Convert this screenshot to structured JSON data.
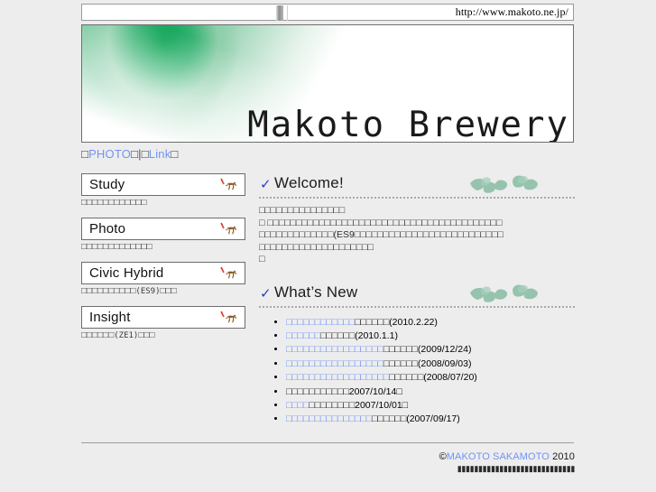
{
  "browser": {
    "url": "http://www.makoto.ne.jp/"
  },
  "banner": {
    "title": "Makoto Brewery",
    "gradient_color": "#00a04c"
  },
  "topnav": {
    "items": [
      {
        "label": "〇PHOTO〇",
        "type": "link"
      },
      {
        "label": "|",
        "type": "separator"
      },
      {
        "label": "〇Link〇",
        "type": "link"
      }
    ],
    "link_color": "#6f94f7",
    "raw": "□PHOTO□|□Link□"
  },
  "sidebar": {
    "items": [
      {
        "label": "Study",
        "caption": "□□□□□□□□□□□□",
        "icon": "cat-icon"
      },
      {
        "label": "Photo",
        "caption": "□□□□□□□□□□□□□",
        "icon": "cat-icon"
      },
      {
        "label": "Civic Hybrid",
        "caption_pre": "□□□□□□□□□□",
        "caption_code": "(ES9)",
        "caption_post": "□□□",
        "icon": "cat-icon"
      },
      {
        "label": "Insight",
        "caption_pre": "□□□□□□",
        "caption_code": "(ZE1)",
        "caption_post": "□□□",
        "icon": "cat-icon"
      }
    ]
  },
  "welcome": {
    "check": "✓",
    "title": "Welcome!",
    "lines": [
      "□□□□□□□□□□□□□□□",
      "□ □□□□□□□□□□□□□□□□□□□□□□□□□□□□□□□□□□□□□□□□□",
      "□□□□□□□□□□□□□(ES9□□□□□□□□□□□□□□□□□□□□□□□□□□",
      "□□□□□□□□□□□□□□□□□□□□",
      "□"
    ]
  },
  "whats_new": {
    "check": "✓",
    "title": "What’s New",
    "items": [
      {
        "link_text": "□□□□□□□□□□□□",
        "black_text": "□□□□□□",
        "date": "(2010.2.22)"
      },
      {
        "link_text": "□□□□□□",
        "black_text": "□□□□□□",
        "date": "(2010.1.1)"
      },
      {
        "link_text": "□□□□□□□□□□□□□□□□□",
        "black_text": "□□□□□□",
        "date": "(2009/12/24)"
      },
      {
        "link_text": "□□□□□□□□□□□□□□□□□",
        "black_text": "□□□□□□",
        "date": "(2008/09/03)"
      },
      {
        "link_text": "□□□□□□□□□□□□□□□□□□",
        "black_text": "□□□□□□",
        "date": "(2008/07/20)"
      },
      {
        "link_text": "",
        "black_text": "□□□□□□□□□□□",
        "date": "2007/10/14□"
      },
      {
        "link_text": "□□□□",
        "black_text": "□□□□□□□□",
        "date": "2007/10/01□"
      },
      {
        "link_text": "□□□□□□□□□□□□□□□",
        "black_text": "□□□□□□",
        "date": "(2007/09/17)"
      }
    ]
  },
  "footer": {
    "copyright_symbol": "©",
    "owner": "MAKOTO SAKAMOTO",
    "year": "2010",
    "sub": "▮▮▮▮▮▮▮▮▮▮▮▮▮▮▮▮▮▮▮▮▮▮▮▮▮▮▮▮",
    "link_color": "#6f94f7"
  }
}
